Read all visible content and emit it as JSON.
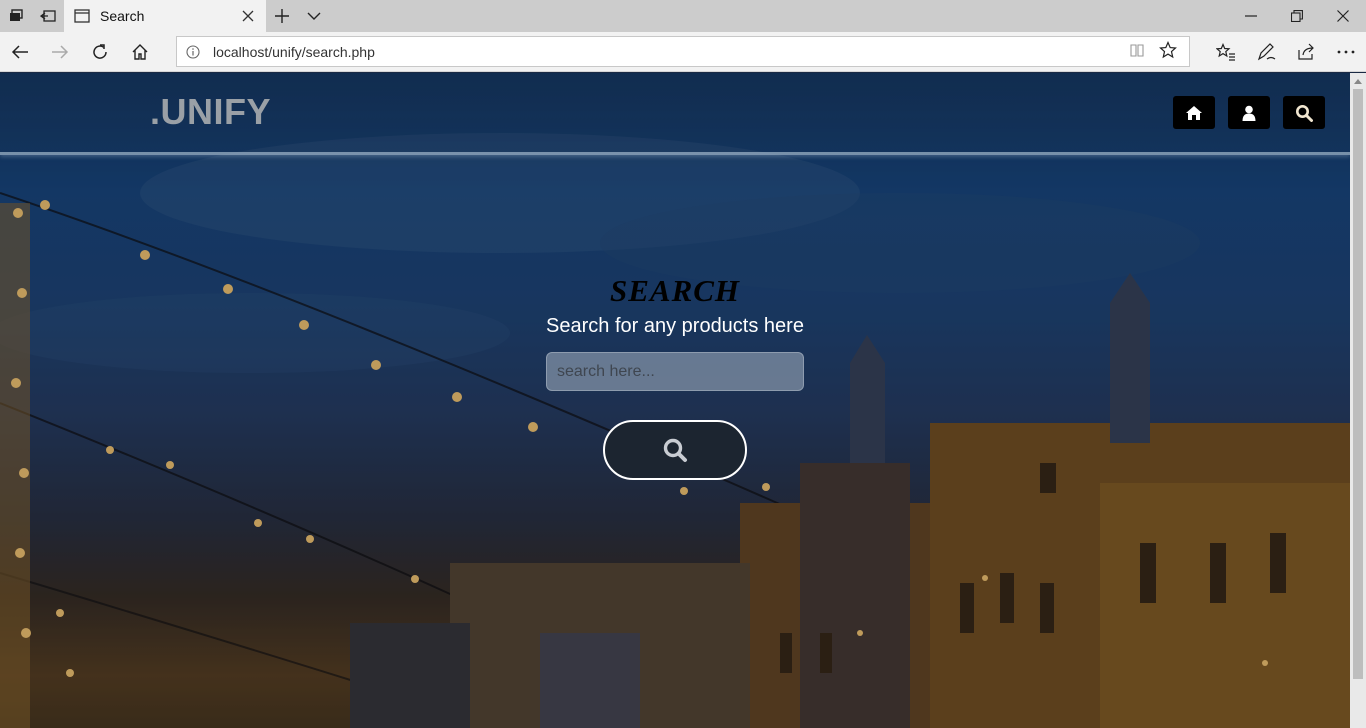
{
  "browser": {
    "tab_title": "Search",
    "url": "localhost/unify/search.php"
  },
  "site": {
    "brand": ".UNIFY",
    "header_icons": [
      "home-icon",
      "user-icon",
      "search-icon"
    ]
  },
  "search": {
    "title": "SEARCH",
    "subtitle": "Search for any products here",
    "placeholder": "search here..."
  },
  "colors": {
    "header_icon_bg": "#000000",
    "brand_text": "#9aa0a6",
    "search_button_bg": "#1c2530"
  }
}
